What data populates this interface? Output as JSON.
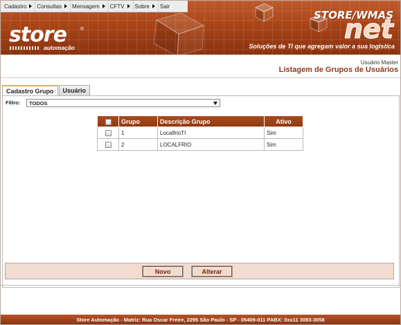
{
  "menu": {
    "items": [
      {
        "label": "Cadastro",
        "has_submenu": true
      },
      {
        "label": "Consultas",
        "has_submenu": true
      },
      {
        "label": "Mensagem",
        "has_submenu": true
      },
      {
        "label": "CFTV",
        "has_submenu": true
      },
      {
        "label": "Sobre",
        "has_submenu": true
      },
      {
        "label": "Sair",
        "has_submenu": false
      }
    ]
  },
  "brand": {
    "logo_text": "store",
    "logo_registered": "®",
    "logo_subtitle": "automação",
    "product_top": "STORE/WMAS",
    "product_big": "net",
    "tagline": "Soluções de TI que agregam valor a sua logística",
    "accent_color": "#a84517"
  },
  "header": {
    "user": "Usuário Master",
    "title": "Listagem de Grupos de Usuários"
  },
  "tabs": [
    {
      "label": "Cadastro Grupo",
      "active": true
    },
    {
      "label": "Usuário",
      "active": false
    }
  ],
  "filter": {
    "label": "Filtro:",
    "selected": "TODOS"
  },
  "table": {
    "columns": [
      "Grupo",
      "Descrição Grupo",
      "Ativo"
    ],
    "rows": [
      {
        "grupo": "1",
        "descricao": "LocalfrioTI",
        "ativo": "Sim",
        "checked": false
      },
      {
        "grupo": "2",
        "descricao": "LOCALFRIO",
        "ativo": "Sim",
        "checked": false
      }
    ]
  },
  "actions": {
    "new_label": "Novo",
    "edit_label": "Alterar"
  },
  "footer": {
    "text": "Store Automação - Matriz: Rua Oscar Freire, 2295 São Paulo - SP - 05409-011 PABX: 0xx11 3083-3058"
  }
}
